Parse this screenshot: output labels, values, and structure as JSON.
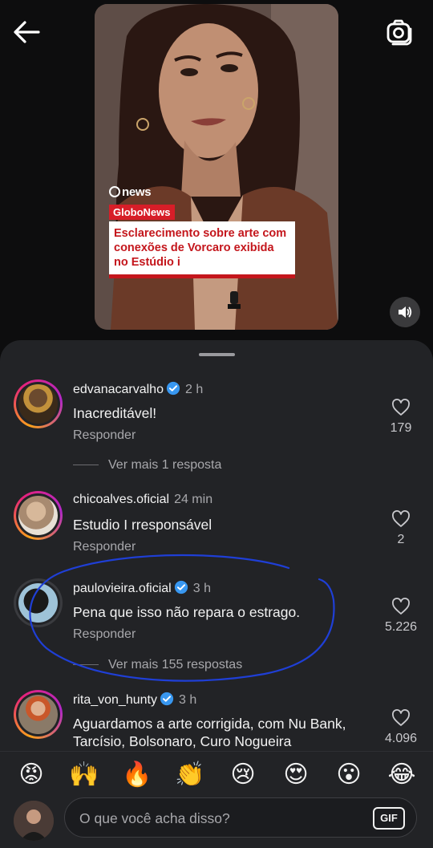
{
  "video": {
    "brand": "news",
    "channel": "GloboNews",
    "headline": "Esclarecimento sobre arte com conexões de Vorcaro exibida no Estúdio i"
  },
  "comments": [
    {
      "username": "edvanacarvalho",
      "verified": true,
      "time": "2 h",
      "text": "Inacreditável!",
      "reply_label": "Responder",
      "likes": "179",
      "more_replies": "Ver mais 1 resposta"
    },
    {
      "username": "chicoalves.oficial",
      "verified": false,
      "time": "24 min",
      "text": "Estudio I rresponsável",
      "reply_label": "Responder",
      "likes": "2"
    },
    {
      "username": "paulovieira.oficial",
      "verified": true,
      "time": "3 h",
      "text": "Pena que isso não repara o estrago.",
      "reply_label": "Responder",
      "likes": "5.226",
      "more_replies": "Ver mais 155 respostas"
    },
    {
      "username": "rita_von_hunty",
      "verified": true,
      "time": "3 h",
      "text": "Aguardamos a arte corrigida, com Nu Bank, Tarcísio, Bolsonaro, Curo Nogueira",
      "likes": "4.096"
    }
  ],
  "emojis": [
    "😡",
    "🙌",
    "🔥",
    "👏",
    "😢",
    "😍",
    "😮",
    "😂"
  ],
  "composer": {
    "placeholder": "O que você acha disso?",
    "gif_label": "GIF"
  },
  "colors": {
    "background": "#0b0b0c",
    "sheet": "#222326",
    "verified": "#3897f0",
    "annotation": "#1f3fd6",
    "headline_red": "#c4161c"
  }
}
